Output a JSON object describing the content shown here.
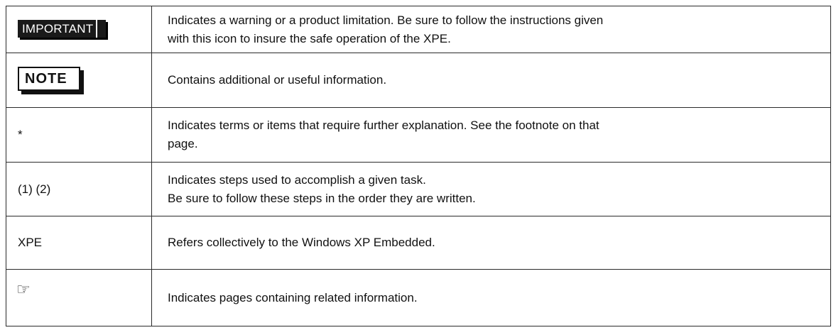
{
  "rows": [
    {
      "symbol": "IMPORTANT",
      "description_lines": [
        "Indicates a warning or a product limitation. Be sure to follow the instructions given",
        "with this icon to insure the safe operation of the XPE."
      ]
    },
    {
      "symbol": "NOTE",
      "description_lines": [
        "Contains additional or useful information."
      ]
    },
    {
      "symbol": "*",
      "description_lines": [
        "Indicates terms or items that require further explanation. See the footnote on that",
        "page."
      ]
    },
    {
      "symbol": "(1) (2)",
      "description_lines": [
        "Indicates steps used to accomplish a given task.",
        "Be sure to follow these steps in the order they are written."
      ]
    },
    {
      "symbol": "XPE",
      "description_lines": [
        "Refers collectively to the Windows XP Embedded."
      ]
    },
    {
      "symbol": "☞",
      "symbol_icon": "pointing-hand-icon",
      "description_lines": [
        "Indicates pages containing related information."
      ]
    }
  ]
}
